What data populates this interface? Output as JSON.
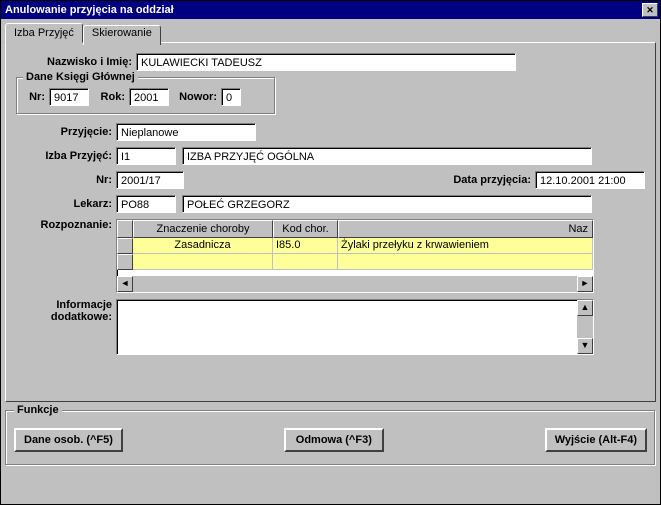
{
  "window": {
    "title": "Anulowanie przyjęcia na oddział"
  },
  "tabs": {
    "izba": "Izba Przyjęć",
    "skierowanie": "Skierowanie"
  },
  "labels": {
    "name": "Nazwisko i Imię:",
    "ledger": "Dane Księgi Głównej",
    "nr": "Nr:",
    "rok": "Rok:",
    "nowor": "Nowor:",
    "przyjecie": "Przyjęcie:",
    "izba": "Izba Przyjęć:",
    "nr2": "Nr:",
    "data": "Data przyjęcia:",
    "lekarz": "Lekarz:",
    "rozpoznanie": "Rozpoznanie:",
    "info": "Informacje dodatkowe:",
    "funkcje": "Funkcje"
  },
  "values": {
    "name": "KULAWIECKI TADEUSZ",
    "nr": "9017",
    "rok": "2001",
    "nowor": "0",
    "przyjecie": "Nieplanowe",
    "izba_code": "I1",
    "izba_name": "IZBA PRZYJĘĆ OGÓLNA",
    "nr2": "2001/17",
    "data": "12.10.2001 21:00",
    "lekarz_code": "PO88",
    "lekarz_name": "POŁEĆ GRZEGORZ",
    "info": ""
  },
  "grid": {
    "headers": {
      "znaczenie": "Znaczenie choroby",
      "kod": "Kod chor.",
      "naz": "Naz"
    },
    "rows": [
      {
        "znaczenie": "Zasadnicza",
        "kod": "I85.0",
        "naz": "Żylaki przełyku z krwawieniem"
      }
    ]
  },
  "buttons": {
    "dane_osob": "Dane osob. (^F5)",
    "odmowa": "Odmowa (^F3)",
    "wyjscie": "Wyjście (Alt-F4)"
  }
}
